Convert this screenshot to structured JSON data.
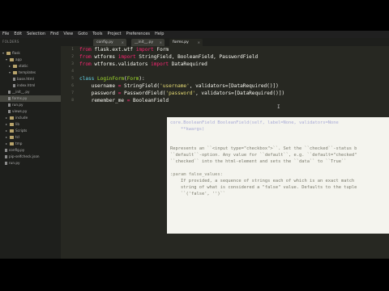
{
  "menu": [
    "File",
    "Edit",
    "Selection",
    "Find",
    "View",
    "Goto",
    "Tools",
    "Project",
    "Preferences",
    "Help"
  ],
  "sidebar": {
    "title": "FOLDERS",
    "items": [
      {
        "label": "flask",
        "type": "folder",
        "toggle": "▾"
      },
      {
        "label": "app",
        "type": "folder",
        "toggle": "▾"
      },
      {
        "label": "static",
        "type": "folder",
        "toggle": "▸"
      },
      {
        "label": "templates",
        "type": "folder",
        "toggle": "▾"
      },
      {
        "label": "base.html",
        "type": "file"
      },
      {
        "label": "index.html",
        "type": "file"
      },
      {
        "label": "__init__.py",
        "type": "file"
      },
      {
        "label": "forms.py",
        "type": "file",
        "selected": true
      },
      {
        "label": "run.py",
        "type": "file"
      },
      {
        "label": "views.py",
        "type": "file"
      },
      {
        "label": "include",
        "type": "folder",
        "toggle": "▸"
      },
      {
        "label": "lib",
        "type": "folder",
        "toggle": "▸"
      },
      {
        "label": "Scripts",
        "type": "folder",
        "toggle": "▸"
      },
      {
        "label": "tcl",
        "type": "folder",
        "toggle": "▸"
      },
      {
        "label": "tmp",
        "type": "folder",
        "toggle": "▸"
      },
      {
        "label": "config.py",
        "type": "file"
      },
      {
        "label": "pip-selfcheck.json",
        "type": "file"
      },
      {
        "label": "run.py",
        "type": "file"
      }
    ]
  },
  "tabs": [
    {
      "label": "config.py",
      "active": false,
      "close": "×"
    },
    {
      "label": "__init__.py",
      "active": false,
      "close": "×"
    },
    {
      "label": "forms.py",
      "active": true,
      "close": "×"
    }
  ],
  "gutter": [
    "1",
    "2",
    "3",
    "4",
    "5",
    "6",
    "7",
    "8"
  ],
  "code": {
    "l1": {
      "kw1": "from",
      "mod": " flask.ext.wtf ",
      "kw2": "import",
      "name": " Form"
    },
    "l2": {
      "kw1": "from",
      "mod": " wtforms ",
      "kw2": "import",
      "name": " StringField, BooleanField, PasswordField"
    },
    "l3": {
      "kw1": "from",
      "mod": " wtforms.validators ",
      "kw2": "import",
      "name": " DataRequired"
    },
    "l5": {
      "kw": "class",
      "name": " LoginForm",
      "paren": "(",
      "base": "Form",
      "end": "):"
    },
    "l6": {
      "indent": "    username ",
      "op": "=",
      "call": " StringField(",
      "str": "'username'",
      "rest": ", validators=[DataRequired()])"
    },
    "l7": {
      "indent": "    password ",
      "op": "=",
      "call": " PasswordField(",
      "str": "'password'",
      "rest": ", validators=[DataRequired()])"
    },
    "l8": {
      "indent": "    remember_me ",
      "op": "=",
      "call": " BooleanField"
    }
  },
  "cursor": "I",
  "doc_popup": {
    "signature": "core.BooleanField BooleanField(self, label=None, validators=None",
    "signature2": "    **kwargs)",
    "desc1": "Represents an ``<input type=\"checkbox\">``. Set the ``checked``-status b",
    "desc2": "``default``-option. Any value for ``default``, e.g. ``default=\"checked\"",
    "desc3": "``checked`` into the html-element and sets the ``data`` to ``True``",
    "param": ":param false_values:",
    "param1": "    If provided, a sequence of strings each of which is an exact match",
    "param2": "    string of what is considered a \"false\" value. Defaults to the tuple",
    "param3": "    ``('false', '')``"
  }
}
